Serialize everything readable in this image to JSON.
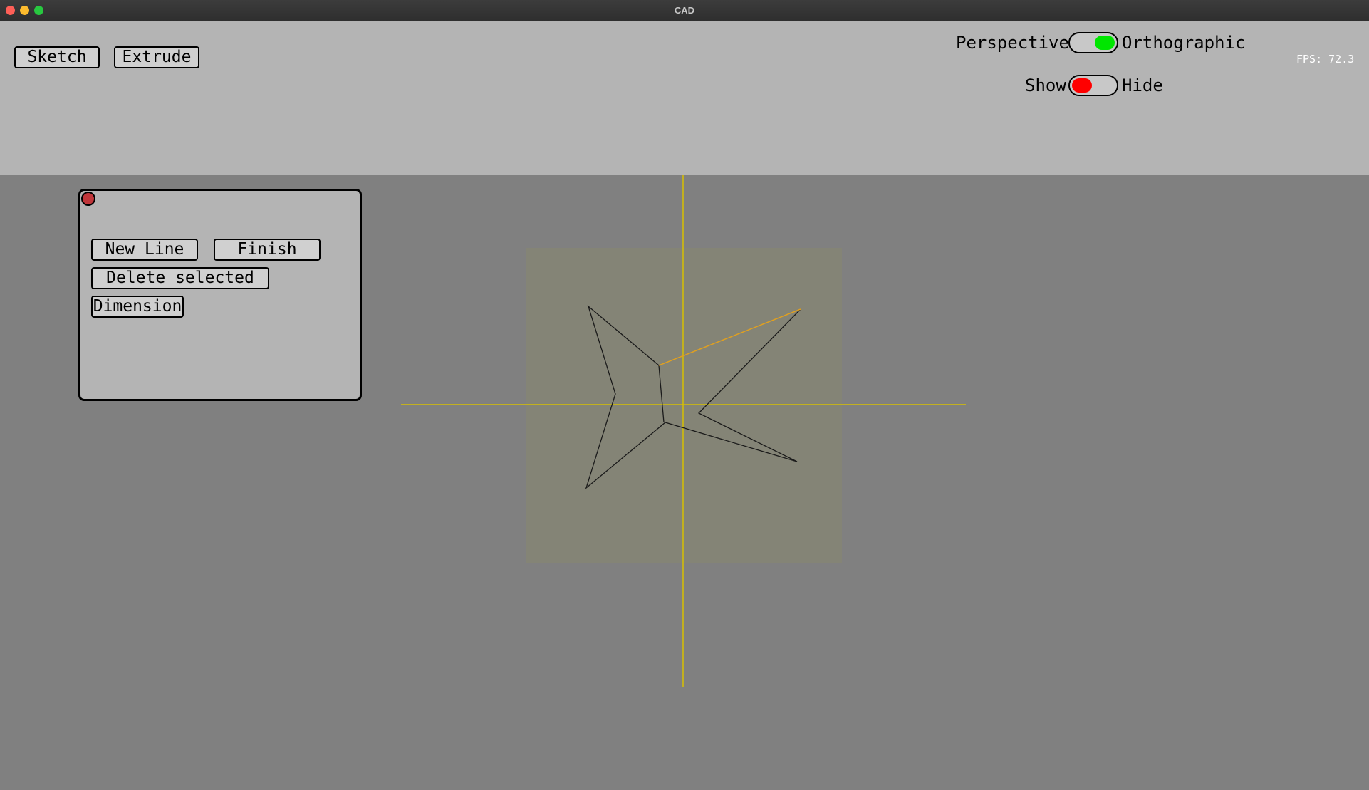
{
  "window": {
    "title": "CAD"
  },
  "toolbar": {
    "sketch_label": "Sketch",
    "extrude_label": "Extrude"
  },
  "projection": {
    "left_label": "Perspective",
    "right_label": "Orthographic",
    "state": "orthographic",
    "knob_color": "#00e600"
  },
  "grid_visibility": {
    "left_label": "Show",
    "right_label": "Hide",
    "state": "show",
    "knob_color": "#ff0000"
  },
  "fps": "FPS: 72.3",
  "sketch_panel": {
    "new_line_label": "New Line",
    "finish_label": "Finish",
    "delete_label": "Delete selected",
    "dimension_label": "Dimension"
  },
  "colors": {
    "viewport_bg": "#808080",
    "toolbar_bg": "#b4b4b4",
    "axis": "#d7c000",
    "sketch_line": "#1a1a1a",
    "selected_line": "#e0a020",
    "sketch_plane": "#8a8a6a"
  }
}
